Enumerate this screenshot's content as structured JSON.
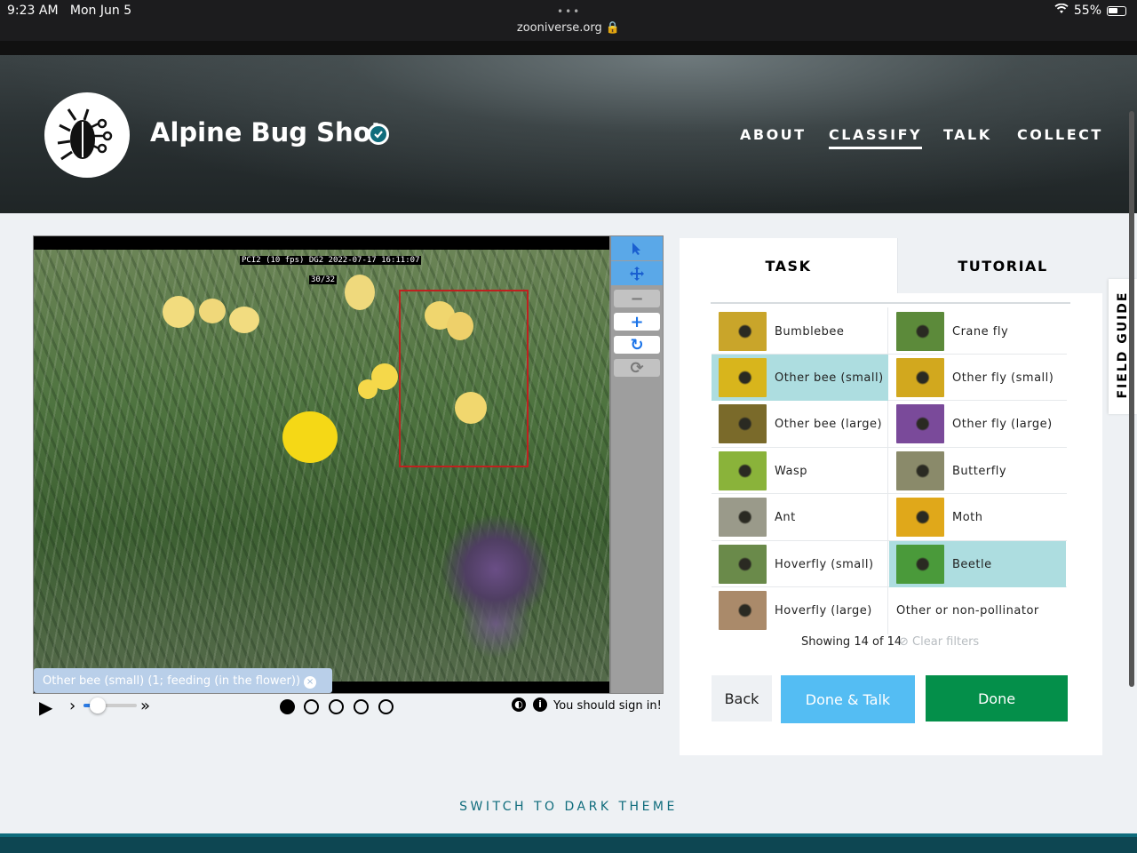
{
  "status": {
    "time": "9:23 AM",
    "date": "Mon Jun 5",
    "url": "zooniverse.org",
    "battery": "55%"
  },
  "project": {
    "title": "Alpine Bug Shot"
  },
  "nav": {
    "about": "ABOUT",
    "classify": "CLASSIFY",
    "talk": "TALK",
    "collect": "COLLECT"
  },
  "viewer": {
    "overlay_line1": "PCI2 (10 fps) DG2 2022-07-17 16:11:07",
    "overlay_line2": "30/32",
    "annotation_label": "Other bee (small) (1; feeding (in the flower))",
    "frames_total": 5,
    "frame_current": 1,
    "playback_speed_fraction": 0.25,
    "signin_notice": "You should sign in!"
  },
  "tabs": {
    "task": "TASK",
    "tutorial": "TUTORIAL"
  },
  "field_guide": "FIELD GUIDE",
  "choices": [
    {
      "label": "Bumblebee",
      "selected": false,
      "color": "#c9a52a"
    },
    {
      "label": "Crane fly",
      "selected": false,
      "color": "#5c8a3a"
    },
    {
      "label": "Other bee (small)",
      "selected": true,
      "color": "#d8b51c"
    },
    {
      "label": "Other fly (small)",
      "selected": false,
      "color": "#d2a81e"
    },
    {
      "label": "Other bee (large)",
      "selected": false,
      "color": "#7a6a2a"
    },
    {
      "label": "Other fly (large)",
      "selected": false,
      "color": "#7a4a9a"
    },
    {
      "label": "Wasp",
      "selected": false,
      "color": "#8ab33a"
    },
    {
      "label": "Butterfly",
      "selected": false,
      "color": "#8a8a6a"
    },
    {
      "label": "Ant",
      "selected": false,
      "color": "#9a9a8a"
    },
    {
      "label": "Moth",
      "selected": false,
      "color": "#e0a81a"
    },
    {
      "label": "Hoverfly (small)",
      "selected": false,
      "color": "#6a8a4a"
    },
    {
      "label": "Beetle",
      "selected": true,
      "color": "#4a9a3a"
    },
    {
      "label": "Hoverfly (large)",
      "selected": false,
      "color": "#aa8a6a"
    },
    {
      "label": "Other or non-pollinator",
      "selected": false,
      "color": null
    }
  ],
  "filter": {
    "showing": "Showing 14 of 14",
    "clear": "Clear filters"
  },
  "buttons": {
    "back": "Back",
    "done_talk": "Done & Talk",
    "done": "Done"
  },
  "footer": {
    "dark_theme": "SWITCH TO DARK THEME"
  },
  "colors": {
    "selected_choice": "#addde0",
    "done": "#048f4a",
    "done_talk": "#54bdf3",
    "accent": "#0f6c7c"
  }
}
